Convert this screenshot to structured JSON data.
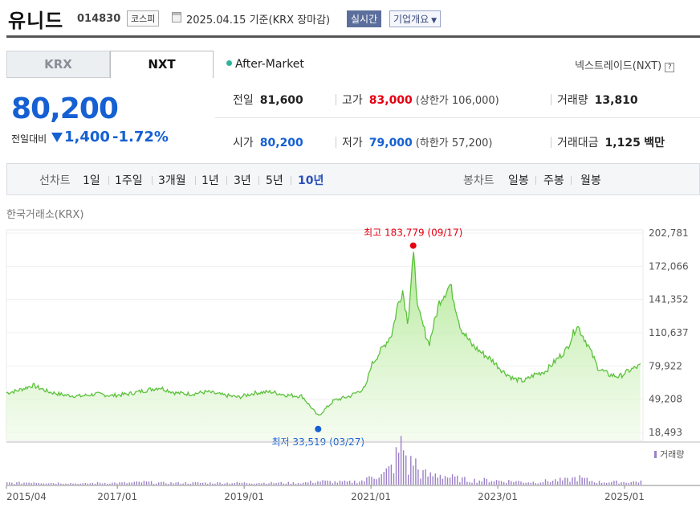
{
  "header": {
    "name": "유니드",
    "code": "014830",
    "market": "코스피",
    "date": "2025.04.15",
    "basis": "기준(KRX 장마감)",
    "realtime_btn": "실시간",
    "info_btn": "기업개요"
  },
  "tabs": [
    {
      "label": "KRX",
      "active": false
    },
    {
      "label": "NXT",
      "active": true
    }
  ],
  "session": "After-Market",
  "nextrade_link": "넥스트레이드(NXT)",
  "help_icon": "?",
  "price": {
    "current": "80,200",
    "change_label": "전일대비",
    "change": "1,400",
    "change_pct": "-1.72%",
    "direction": "down"
  },
  "stats": {
    "prev_label": "전일",
    "prev": "81,600",
    "high_label": "고가",
    "high": "83,000",
    "upper_label": "상한가",
    "upper": "106,000",
    "volume_label": "거래량",
    "volume": "13,810",
    "open_label": "시가",
    "open": "80,200",
    "low_label": "저가",
    "low": "79,000",
    "lower_label": "하한가",
    "lower": "57,200",
    "amount_label": "거래대금",
    "amount": "1,125",
    "amount_unit": "백만"
  },
  "periods": {
    "line_label": "선차트",
    "line_items": [
      "1일",
      "1주일",
      "3개월",
      "1년",
      "3년",
      "5년",
      "10년"
    ],
    "selected": "10년",
    "candle_label": "봉차트",
    "candle_items": [
      "일봉",
      "주봉",
      "월봉"
    ]
  },
  "source": "한국거래소(KRX)",
  "colors": {
    "price_down": "#1560d2",
    "price_up": "#e60012",
    "line": "#5cc23c",
    "fill": "#c9f0b3",
    "volume": "#9b7fc7"
  },
  "chart_data": {
    "type": "area",
    "yticks": [
      202781,
      172066,
      141352,
      110637,
      79922,
      49208,
      18493
    ],
    "ylim": [
      18493,
      202781
    ],
    "xticks": [
      "2015/04",
      "2017/01",
      "2019/01",
      "2021/01",
      "2023/01",
      "2025/01"
    ],
    "x": [
      "2015/04",
      "2015/06",
      "2015/09",
      "2015/12",
      "2016/03",
      "2016/06",
      "2016/09",
      "2016/12",
      "2017/03",
      "2017/06",
      "2017/09",
      "2017/12",
      "2018/03",
      "2018/06",
      "2018/09",
      "2018/12",
      "2019/03",
      "2019/06",
      "2019/09",
      "2019/12",
      "2020/03",
      "2020/06",
      "2020/09",
      "2020/12",
      "2021/01",
      "2021/03",
      "2021/05",
      "2021/06",
      "2021/07",
      "2021/08",
      "2021/09",
      "2021/10",
      "2021/12",
      "2022/02",
      "2022/04",
      "2022/06",
      "2022/08",
      "2022/10",
      "2022/12",
      "2023/02",
      "2023/04",
      "2023/06",
      "2023/08",
      "2023/10",
      "2023/12",
      "2024/02",
      "2024/04",
      "2024/06",
      "2024/08",
      "2024/10",
      "2024/12",
      "2025/02",
      "2025/04"
    ],
    "values": [
      55000,
      57000,
      62000,
      56000,
      53000,
      52000,
      54000,
      52500,
      54000,
      57000,
      60000,
      55000,
      54000,
      56000,
      53000,
      51000,
      55000,
      56000,
      53000,
      52000,
      33519,
      48000,
      52000,
      60000,
      80000,
      95000,
      110000,
      135000,
      150000,
      120000,
      183779,
      130000,
      100000,
      140000,
      155000,
      115000,
      100000,
      92000,
      85000,
      75000,
      68000,
      66000,
      72000,
      75000,
      85000,
      95000,
      118000,
      100000,
      78000,
      72000,
      70000,
      76000,
      80200
    ],
    "volume": [
      2,
      2,
      3,
      2,
      2,
      1,
      2,
      2,
      2,
      3,
      2,
      2,
      2,
      2,
      2,
      2,
      2,
      2,
      2,
      2,
      4,
      3,
      3,
      5,
      12,
      10,
      20,
      35,
      45,
      18,
      30,
      14,
      10,
      12,
      8,
      6,
      5,
      5,
      5,
      4,
      4,
      3,
      3,
      4,
      5,
      5,
      8,
      5,
      3,
      3,
      3,
      3,
      4
    ],
    "annotations": {
      "high_label": "최고",
      "high": "183,779",
      "high_date": "(09/17)",
      "low_label": "최저",
      "low": "33,519",
      "low_date": "(03/27)",
      "volume_legend": "거래량"
    }
  }
}
